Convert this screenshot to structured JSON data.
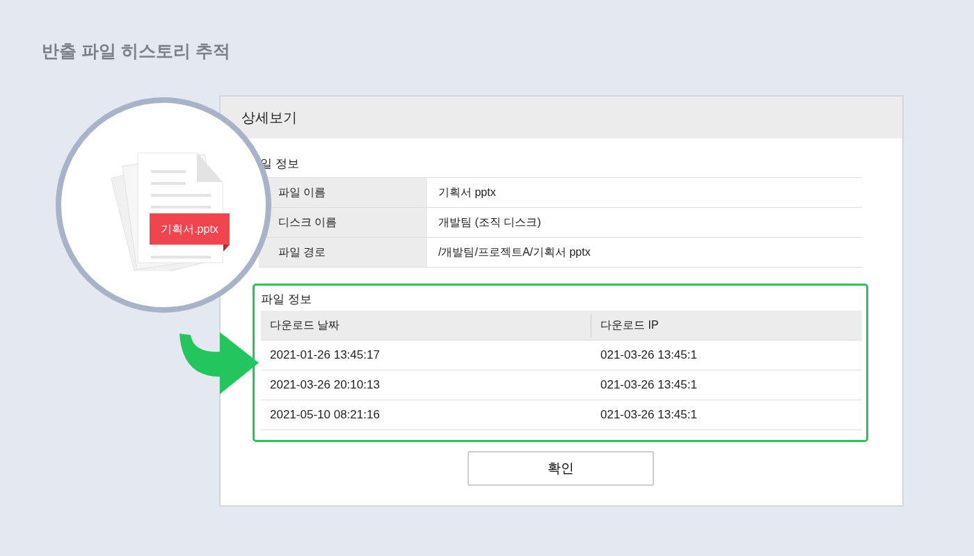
{
  "page_title": "반출 파일 히스토리 추적",
  "illustration": {
    "file_label": "기획서.pptx"
  },
  "dialog": {
    "title": "상세보기",
    "file_info": {
      "heading": "일 정보",
      "rows": [
        {
          "label": "파일 이름",
          "value": "기획서 pptx"
        },
        {
          "label": "디스크 이름",
          "value": "개발팀 (조직 디스크)"
        },
        {
          "label": "파일 경로",
          "value": "/개발팀/프로젝트A/기획서 pptx"
        }
      ]
    },
    "downloads": {
      "heading": "파일 정보",
      "columns": [
        "다운로드 날짜",
        "다운로드 IP"
      ],
      "rows": [
        [
          "2021-01-26 13:45:17",
          "021-03-26 13:45:1"
        ],
        [
          "2021-03-26 20:10:13",
          "021-03-26 13:45:1"
        ],
        [
          "2021-05-10 08:21:16",
          "021-03-26 13:45:1"
        ]
      ]
    },
    "buttons": [
      "확인"
    ]
  }
}
